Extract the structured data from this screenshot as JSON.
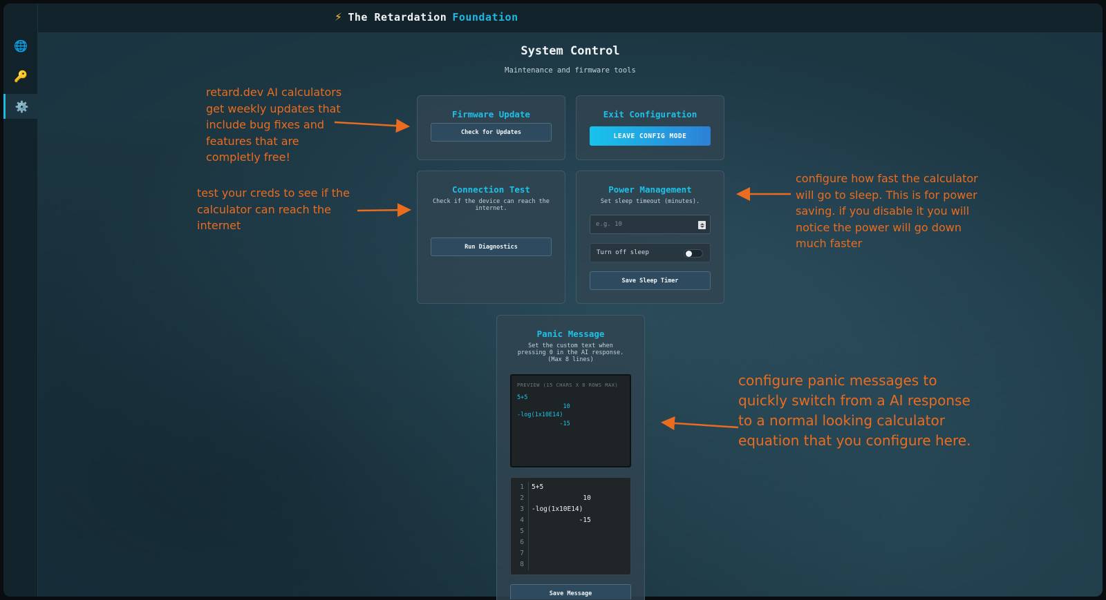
{
  "brand": {
    "icon": "lightning-bolt-icon",
    "name_part1": "The Retardation",
    "name_part2": "Foundation"
  },
  "sidebar": {
    "items": [
      {
        "icon": "globe-icon",
        "glyph": "🌐"
      },
      {
        "icon": "key-icon",
        "glyph": "🔑"
      },
      {
        "icon": "gear-icon",
        "glyph": "⚙️",
        "active": true
      }
    ]
  },
  "page": {
    "title": "System Control",
    "subtitle": "Maintenance and firmware tools"
  },
  "firmware": {
    "title": "Firmware Update",
    "button": "Check for Updates"
  },
  "exit_config": {
    "title": "Exit Configuration",
    "button": "LEAVE CONFIG MODE"
  },
  "connection": {
    "title": "Connection Test",
    "desc": "Check if the device can reach the internet.",
    "button": "Run Diagnostics"
  },
  "power": {
    "title": "Power Management",
    "desc": "Set sleep timeout (minutes).",
    "input_placeholder": "e.g. 10",
    "toggle_label": "Turn off sleep",
    "toggle_on": false,
    "button": "Save Sleep Timer"
  },
  "panic": {
    "title": "Panic Message",
    "desc": "Set the custom text when pressing 0 in the AI response. (Max 8 lines)",
    "preview_header": "PREVIEW (15 CHARS X 8 ROWS MAX)",
    "lines": [
      "5+5",
      "             10",
      "-log(1x10E14)",
      "            -15",
      "",
      "",
      "",
      ""
    ],
    "line_numbers": [
      "1",
      "2",
      "3",
      "4",
      "5",
      "6",
      "7",
      "8"
    ],
    "button": "Save Message"
  },
  "annotations": {
    "firmware": "retard.dev AI calculators get weekly updates that include bug fixes and features that are completly free!",
    "connection": "test your creds to see if the calculator can reach the internet",
    "power": "configure how fast the calculator will go to sleep. This is for power saving. if you disable it you will notice the power will go down much faster",
    "panic": "configure panic messages to quickly switch from a AI response to a normal looking calculator equation that you configure here."
  },
  "colors": {
    "accent": "#1fb8e0",
    "annotation": "#ea6c1e",
    "bolt": "#f5c431"
  }
}
